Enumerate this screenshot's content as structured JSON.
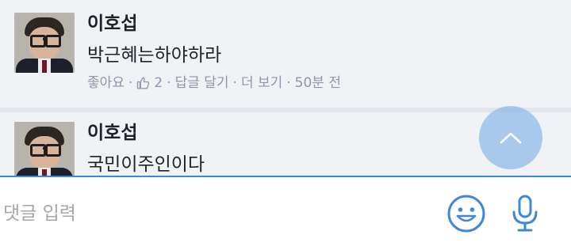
{
  "comments": [
    {
      "author": "이호섭",
      "text": "박근혜는하야하라",
      "actions": {
        "like": "좋아요",
        "like_count": "2",
        "reply": "답글 달기",
        "more": "더 보기",
        "time": "50분 전"
      }
    },
    {
      "author": "이호섭",
      "text": "국민이주인이다"
    }
  ],
  "input": {
    "placeholder": "댓글 입력"
  },
  "colors": {
    "accent": "#3f87d8",
    "meta": "#8d96aa",
    "comment_bg": "#f1f2f6"
  },
  "icons": {
    "scroll_top": "chevron-up-icon",
    "emoji": "smiley-icon",
    "mic": "microphone-icon",
    "like": "thumbs-up-icon"
  }
}
